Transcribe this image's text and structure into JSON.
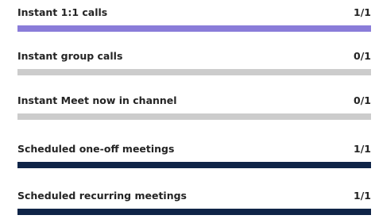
{
  "usage": {
    "items": [
      {
        "label": "Instant 1:1 calls",
        "count_text": "1/1",
        "used": 1,
        "total": 1,
        "fill_color": "#8a7cd9"
      },
      {
        "label": "Instant group calls",
        "count_text": "0/1",
        "used": 0,
        "total": 1,
        "fill_color": "#c8c8c8"
      },
      {
        "label": "Instant Meet now in channel",
        "count_text": "0/1",
        "used": 0,
        "total": 1,
        "fill_color": "#c8c8c8"
      },
      {
        "label": "Scheduled one-off meetings",
        "count_text": "1/1",
        "used": 1,
        "total": 1,
        "fill_color": "#0f2447"
      },
      {
        "label": "Scheduled recurring meetings",
        "count_text": "1/1",
        "used": 1,
        "total": 1,
        "fill_color": "#0f2447"
      }
    ],
    "track_color": "#cccccc"
  }
}
